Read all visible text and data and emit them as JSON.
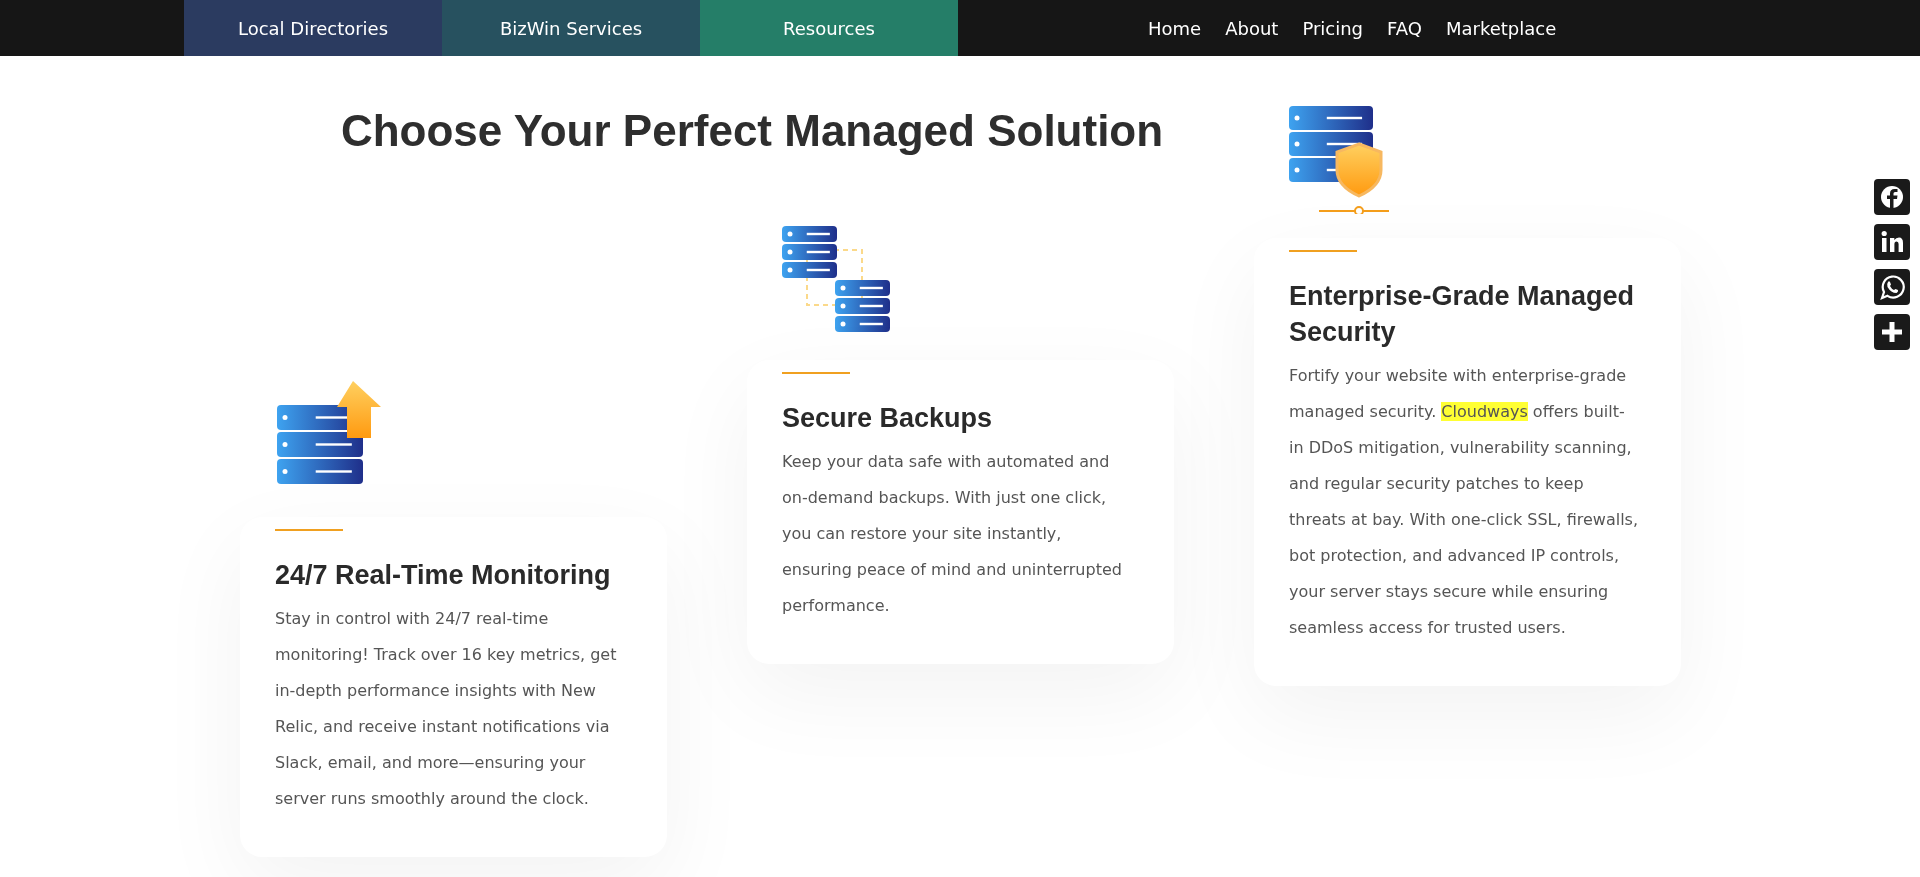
{
  "nav": {
    "tabs": [
      {
        "label": "Local Directories",
        "color": "#2b3b60"
      },
      {
        "label": "BizWin Services",
        "color": "#27515f"
      },
      {
        "label": "Resources",
        "color": "#257e68"
      }
    ],
    "links": [
      "Home",
      "About",
      "Pricing",
      "FAQ",
      "Marketplace"
    ]
  },
  "title": "Choose Your Perfect Managed Solution",
  "features": [
    {
      "kind": "upload",
      "heading": "24/7 Real-Time Monitoring",
      "text": [
        {
          "text": "Stay in control with 24/7 real-time monitoring! Track over 16 key metrics, get in-depth performance insights with New Relic, and receive instant notifications via Slack, email, and more—ensuring your server runs smoothly around the clock.",
          "highlight": false
        }
      ]
    },
    {
      "kind": "backup",
      "heading": "Secure Backups",
      "text": [
        {
          "text": "Keep your data safe with automated and on-demand backups. With just one click, you can restore your site instantly, ensuring peace of mind and uninterrupted performance.",
          "highlight": false
        }
      ]
    },
    {
      "kind": "shield",
      "heading": "Enterprise-Grade Managed Security",
      "text": [
        {
          "text": "Fortify your website with enterprise-grade managed security. ",
          "highlight": false
        },
        {
          "text": "Cloudways",
          "highlight": true
        },
        {
          "text": " offers built-in DDoS mitigation, vulnerability scanning, and regular security patches to keep threats at bay. With one-click SSL, firewalls, bot protection, and advanced IP controls, your server stays secure while ensuring seamless access for trusted users.",
          "highlight": false
        }
      ]
    }
  ],
  "share": [
    {
      "kind": "facebook"
    },
    {
      "kind": "linkedin"
    },
    {
      "kind": "whatsapp"
    },
    {
      "kind": "more"
    }
  ]
}
